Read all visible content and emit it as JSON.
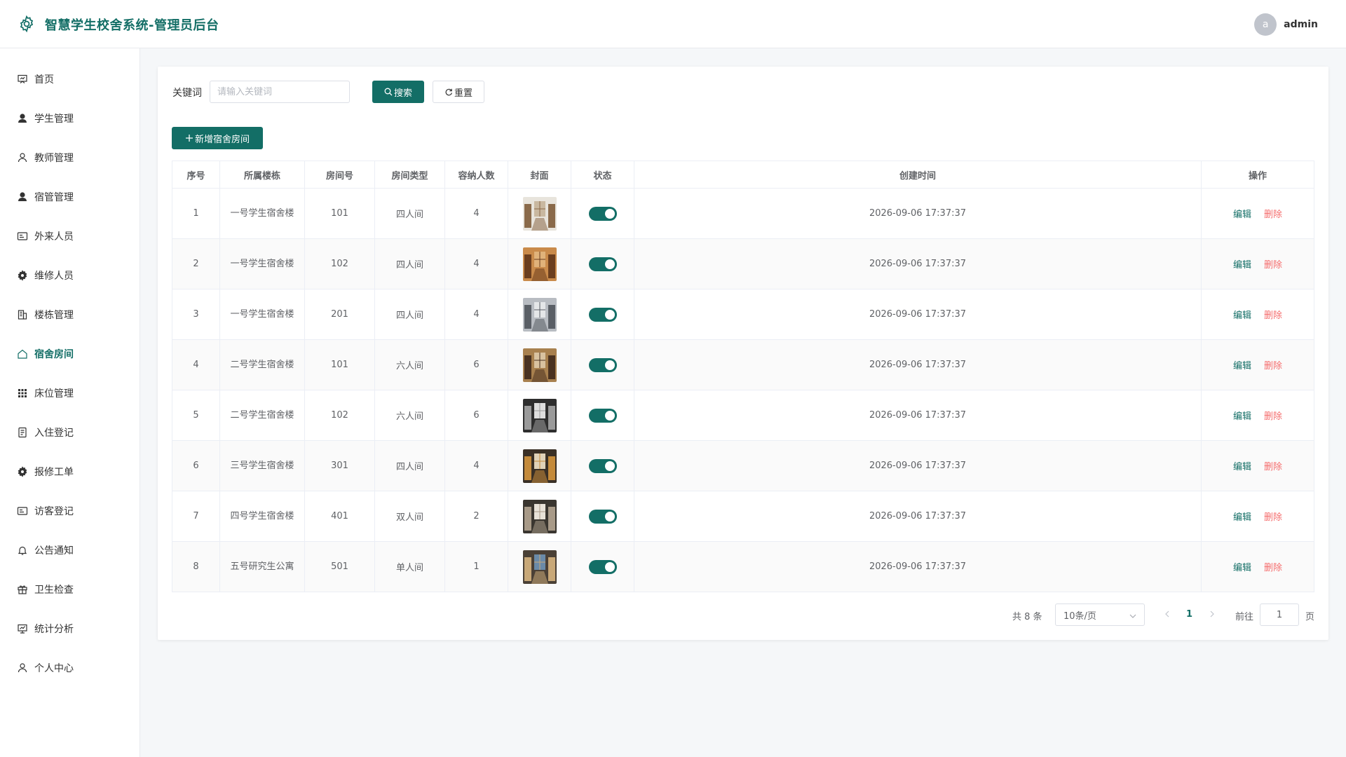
{
  "header": {
    "title": "智慧学生校舍系统-管理员后台",
    "avatar_letter": "a",
    "username": "admin",
    "accent_color": "#136e66"
  },
  "sidebar": {
    "items": [
      {
        "label": "首页",
        "icon": "dashboard-icon"
      },
      {
        "label": "学生管理",
        "icon": "user-filled-icon"
      },
      {
        "label": "教师管理",
        "icon": "user-icon"
      },
      {
        "label": "宿管管理",
        "icon": "user-filled-icon"
      },
      {
        "label": "外来人员",
        "icon": "id-card-icon"
      },
      {
        "label": "维修人员",
        "icon": "gear-icon"
      },
      {
        "label": "楼栋管理",
        "icon": "building-icon"
      },
      {
        "label": "宿舍房间",
        "icon": "house-icon",
        "active": true
      },
      {
        "label": "床位管理",
        "icon": "grid-icon"
      },
      {
        "label": "入住登记",
        "icon": "document-icon"
      },
      {
        "label": "报修工单",
        "icon": "gear-icon"
      },
      {
        "label": "访客登记",
        "icon": "id-card-icon"
      },
      {
        "label": "公告通知",
        "icon": "bell-icon"
      },
      {
        "label": "卫生检查",
        "icon": "present-icon"
      },
      {
        "label": "统计分析",
        "icon": "chart-board-icon"
      },
      {
        "label": "个人中心",
        "icon": "user-icon"
      }
    ]
  },
  "search": {
    "label": "关键词",
    "placeholder": "请输入关键词",
    "value": "",
    "search_button": "搜索",
    "reset_button": "重置"
  },
  "toolbar": {
    "add_button": "新增宿舍房间"
  },
  "table": {
    "columns": [
      "序号",
      "所属楼栋",
      "房间号",
      "房间类型",
      "容纳人数",
      "封面",
      "状态",
      "创建时间",
      "操作"
    ],
    "edit_label": "编辑",
    "delete_label": "删除",
    "rows": [
      {
        "index": "1",
        "building": "一号学生宿舍楼",
        "room": "101",
        "type": "四人间",
        "capacity": "4",
        "cover": "dorm-photo-icon",
        "enabled": true,
        "created": "2026-09-06 17:37:37"
      },
      {
        "index": "2",
        "building": "一号学生宿舍楼",
        "room": "102",
        "type": "四人间",
        "capacity": "4",
        "cover": "dorm-photo-icon",
        "enabled": true,
        "created": "2026-09-06 17:37:37"
      },
      {
        "index": "3",
        "building": "一号学生宿舍楼",
        "room": "201",
        "type": "四人间",
        "capacity": "4",
        "cover": "dorm-photo-icon",
        "enabled": true,
        "created": "2026-09-06 17:37:37"
      },
      {
        "index": "4",
        "building": "二号学生宿舍楼",
        "room": "101",
        "type": "六人间",
        "capacity": "6",
        "cover": "dorm-photo-icon",
        "enabled": true,
        "created": "2026-09-06 17:37:37"
      },
      {
        "index": "5",
        "building": "二号学生宿舍楼",
        "room": "102",
        "type": "六人间",
        "capacity": "6",
        "cover": "dorm-photo-icon",
        "enabled": true,
        "created": "2026-09-06 17:37:37"
      },
      {
        "index": "6",
        "building": "三号学生宿舍楼",
        "room": "301",
        "type": "四人间",
        "capacity": "4",
        "cover": "dorm-photo-icon",
        "enabled": true,
        "created": "2026-09-06 17:37:37"
      },
      {
        "index": "7",
        "building": "四号学生宿舍楼",
        "room": "401",
        "type": "双人间",
        "capacity": "2",
        "cover": "dorm-photo-icon",
        "enabled": true,
        "created": "2026-09-06 17:37:37"
      },
      {
        "index": "8",
        "building": "五号研究生公寓",
        "room": "501",
        "type": "单人间",
        "capacity": "1",
        "cover": "dorm-photo-icon",
        "enabled": true,
        "created": "2026-09-06 17:37:37"
      }
    ]
  },
  "pagination": {
    "total": "共 8 条",
    "page_size": "10条/页",
    "current_page": "1",
    "goto_label": "前往",
    "goto_value": "1",
    "goto_suffix": "页"
  }
}
